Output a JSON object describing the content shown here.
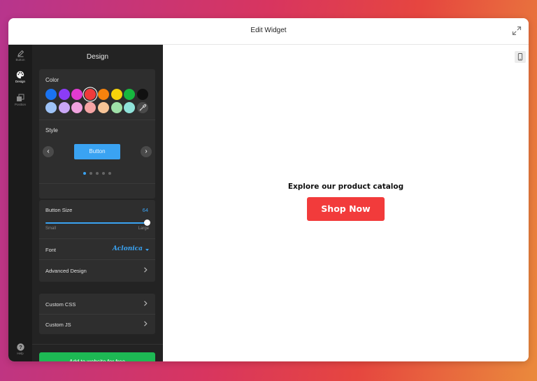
{
  "window": {
    "title": "Edit Widget"
  },
  "rail": {
    "items": [
      {
        "label": "Button",
        "icon": "pencil-icon"
      },
      {
        "label": "Design",
        "icon": "palette-icon"
      },
      {
        "label": "Position",
        "icon": "layers-icon"
      }
    ],
    "help_label": "Help"
  },
  "panel": {
    "title": "Design",
    "color": {
      "label": "Color",
      "swatches_row1": [
        "#1a73f0",
        "#8b3cf7",
        "#e23bd0",
        "#f03b3b",
        "#f5820d",
        "#f7d40a",
        "#17b83f",
        "#111111"
      ],
      "swatches_row2": [
        "#9ec3f7",
        "#c9a7f5",
        "#f0a3df",
        "#f5a4a4",
        "#f7c497",
        "#9fe0a8",
        "#8fe2d9"
      ],
      "selected": "#f03b3b",
      "eyedropper_icon": "eyedropper-icon"
    },
    "style": {
      "label": "Style",
      "preview_label": "Button",
      "dots": 5,
      "active_dot": 0
    },
    "button_size": {
      "label": "Button Size",
      "value": "64",
      "value_fraction": 0.98,
      "min_label": "Small",
      "max_label": "Large"
    },
    "font": {
      "label": "Font",
      "value": "Aclonica"
    },
    "advanced_label": "Advanced Design",
    "custom_css_label": "Custom CSS",
    "custom_js_label": "Custom JS",
    "add_button_label": "Add to website for free"
  },
  "preview": {
    "heading": "Explore our product catalog",
    "button_label": "Shop Now",
    "button_color": "#f23b3b"
  },
  "colors": {
    "accent": "#3aa3f2",
    "primary_green": "#1db954"
  }
}
